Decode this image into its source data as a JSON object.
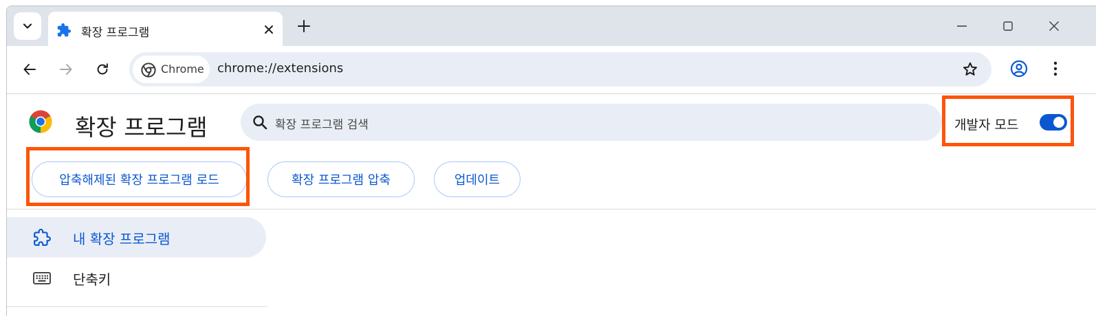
{
  "tabstrip": {
    "tab_title": "확장 프로그램"
  },
  "toolbar": {
    "site_chip": "Chrome",
    "url": "chrome://extensions"
  },
  "header": {
    "title": "확장 프로그램",
    "search_placeholder": "확장 프로그램 검색",
    "developer_mode_label": "개발자 모드",
    "developer_mode_enabled": true
  },
  "actions": {
    "load_unpacked": "압축해제된 확장 프로그램 로드",
    "pack": "확장 프로그램 압축",
    "update": "업데이트"
  },
  "sidebar": {
    "items": [
      {
        "label": "내 확장 프로그램",
        "icon": "puzzle-icon",
        "active": true
      },
      {
        "label": "단축키",
        "icon": "keyboard-icon",
        "active": false
      }
    ]
  },
  "colors": {
    "accent": "#0b57d0",
    "highlight": "#fd5507",
    "surface": "#e9eef6"
  }
}
